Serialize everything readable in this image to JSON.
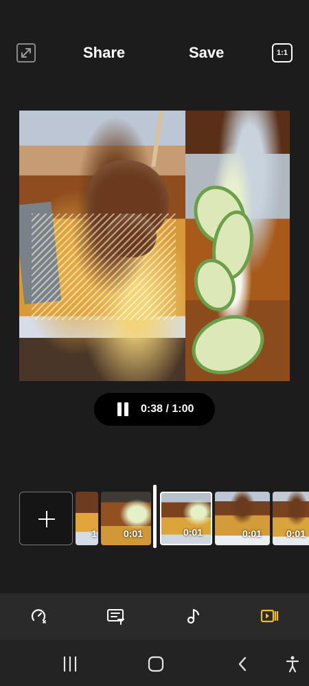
{
  "topbar": {
    "share_label": "Share",
    "save_label": "Save",
    "ratio_label": "1:1",
    "expand_icon": "expand-icon"
  },
  "preview": {
    "left_clip": "food-photo-biryani-with-meat",
    "right_clip": "food-photo-cucumber-slices"
  },
  "playback": {
    "time_text": "0:38 / 1:00",
    "pause_icon": "pause-icon"
  },
  "timeline": {
    "add_clip_icon": "plus-icon",
    "clips": [
      {
        "duration": "1"
      },
      {
        "duration": "0:01"
      },
      {
        "duration": "0:01"
      },
      {
        "duration": "0:01"
      },
      {
        "duration": "0:01"
      }
    ]
  },
  "toolbar": {
    "icons": [
      "speed-icon",
      "text-icon",
      "music-icon",
      "video-clip-icon"
    ],
    "active_color": "#f5c400"
  },
  "navbar": {
    "icons": [
      "recents-icon",
      "home-icon",
      "back-icon",
      "accessibility-icon"
    ]
  }
}
